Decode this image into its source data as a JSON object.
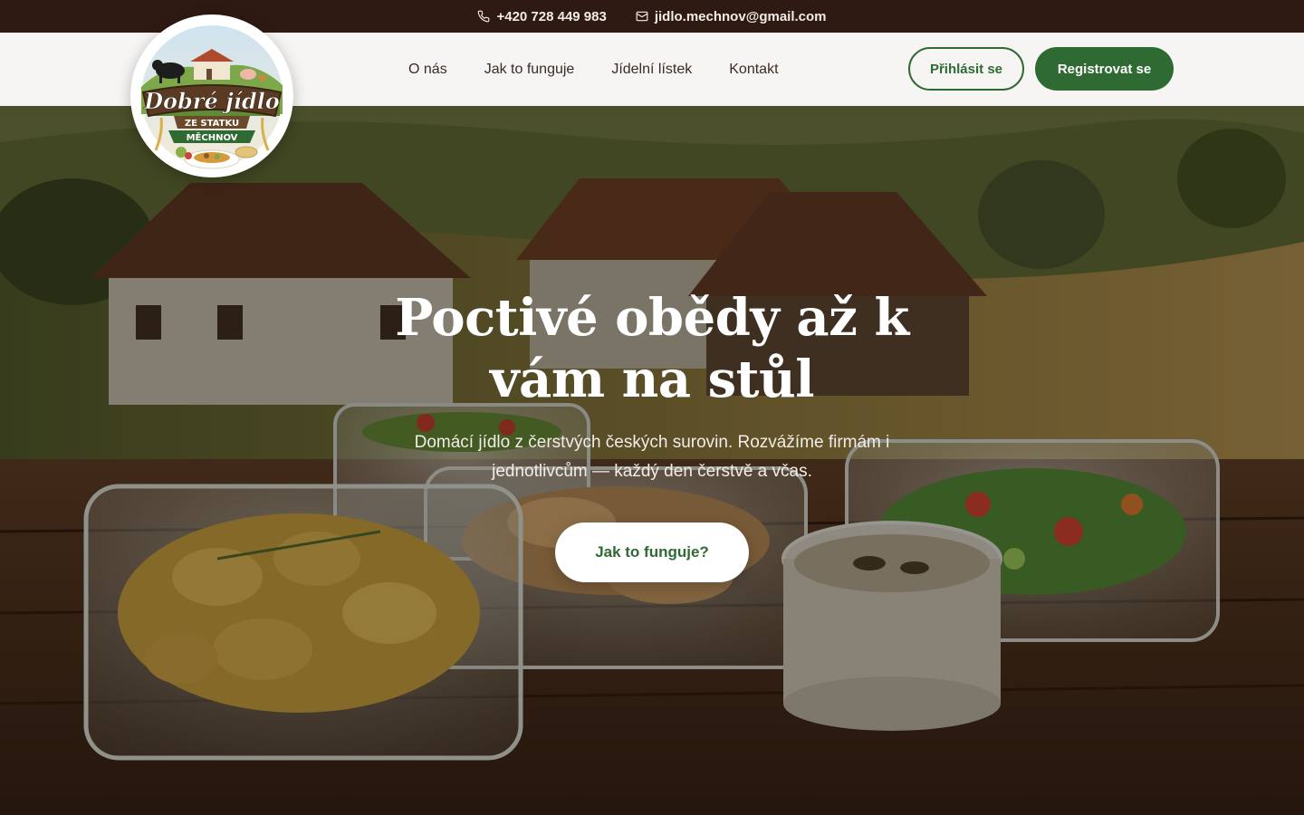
{
  "topbar": {
    "phone": "+420 728 449 983",
    "phone_icon": "phone-icon",
    "email": "jidlo.mechnov@gmail.com",
    "email_icon": "mail-icon"
  },
  "logo": {
    "title": "Dobré jídlo",
    "line2": "ZE STATKU",
    "line3": "MĚCHNOV"
  },
  "nav": {
    "items": [
      {
        "label": "O nás"
      },
      {
        "label": "Jak to funguje"
      },
      {
        "label": "Jídelní lístek"
      },
      {
        "label": "Kontakt"
      }
    ]
  },
  "auth": {
    "login_label": "Přihlásit se",
    "register_label": "Registrovat se"
  },
  "hero": {
    "title": "Poctivé obědy až k vám na stůl",
    "subtitle": "Domácí jídlo z čerstvých českých surovin. Rozvážíme firmám i jednotlivcům — každý den čerstvě a včas.",
    "cta_label": "Jak to funguje?"
  },
  "colors": {
    "brand_green": "#2f6a33",
    "topbar_bg": "#2e1a12",
    "header_bg": "#f6f5f3"
  }
}
